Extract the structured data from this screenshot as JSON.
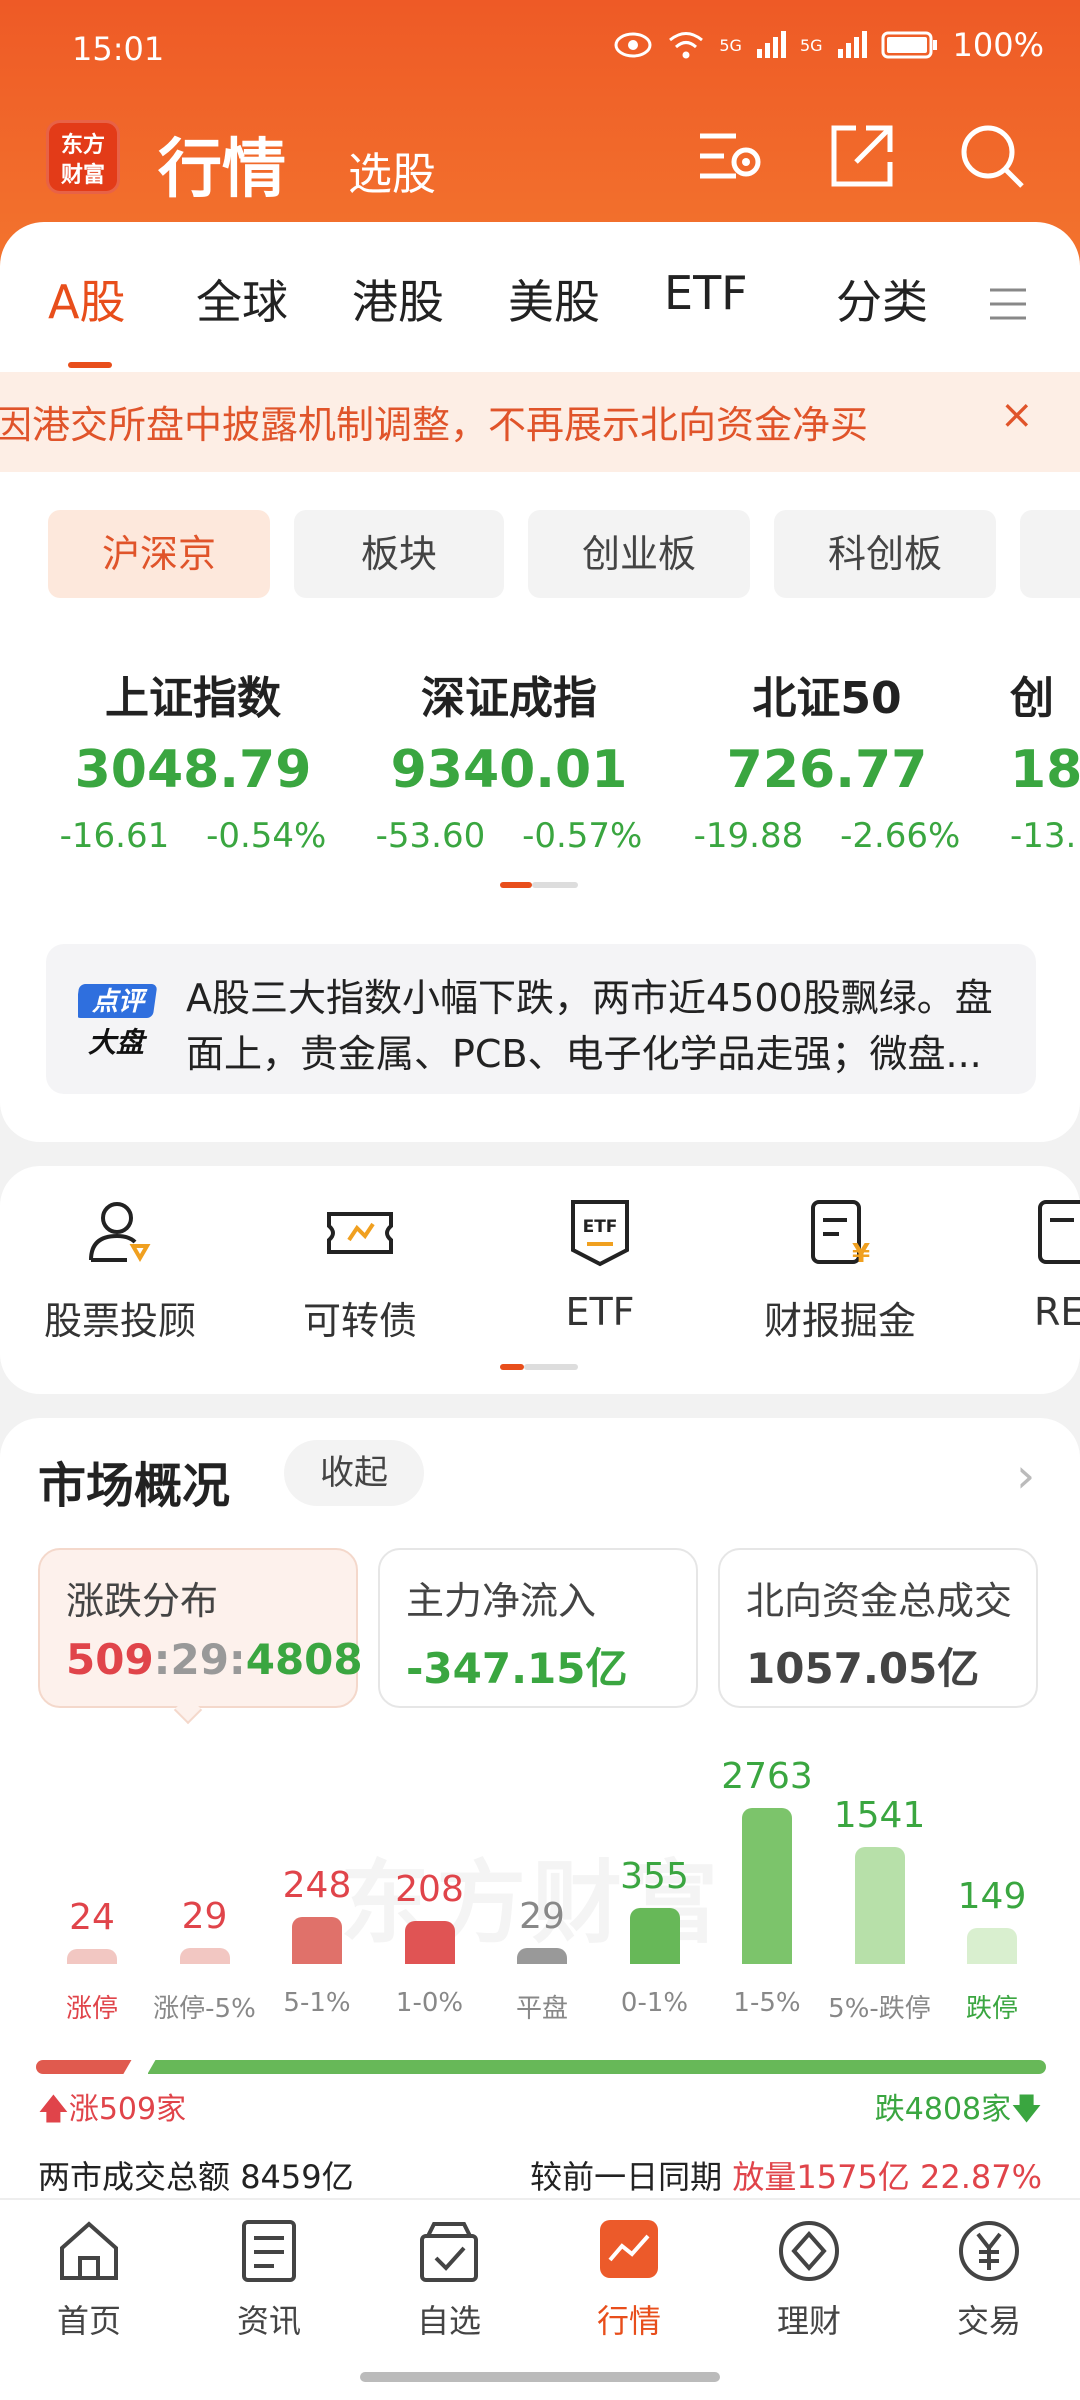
{
  "status": {
    "time": "15:01",
    "battery": "100%",
    "net1": "5G",
    "net2": "5G"
  },
  "header": {
    "logo_line1": "东方",
    "logo_line2": "财富",
    "title": "行情",
    "subtitle": "选股"
  },
  "tabs": [
    {
      "label": "A股"
    },
    {
      "label": "全球"
    },
    {
      "label": "港股"
    },
    {
      "label": "美股"
    },
    {
      "label": "ETF"
    },
    {
      "label": "分类"
    }
  ],
  "banner": {
    "text": "因港交所盘中披露机制调整，不再展示北向资金净买",
    "close": "×"
  },
  "pills": [
    {
      "label": "沪深京"
    },
    {
      "label": "板块"
    },
    {
      "label": "创业板"
    },
    {
      "label": "科创板"
    }
  ],
  "indices": [
    {
      "name": "上证指数",
      "value": "3048.79",
      "change": "-16.61",
      "pct": "-0.54%"
    },
    {
      "name": "深证成指",
      "value": "9340.01",
      "change": "-53.60",
      "pct": "-0.57%"
    },
    {
      "name": "北证50",
      "value": "726.77",
      "change": "-19.88",
      "pct": "-2.66%"
    },
    {
      "name": "创",
      "value": "18",
      "change": "-13.",
      "pct": ""
    }
  ],
  "review": {
    "badge1": "点评",
    "badge2": "大盘",
    "text": "A股三大指数小幅下跌，两市近4500股飘绿。盘面上，贵金属、PCB、电子化学品走强；微盘..."
  },
  "tools": [
    {
      "label": "股票投顾"
    },
    {
      "label": "可转债"
    },
    {
      "label": "ETF"
    },
    {
      "label": "财报掘金"
    },
    {
      "label": "RE"
    }
  ],
  "market": {
    "title": "市场概况",
    "collapse": "收起",
    "cards": [
      {
        "label": "涨跌分布",
        "v1": "509",
        "sep": ":",
        "v2": "29",
        "v3": "4808"
      },
      {
        "label": "主力净流入",
        "value": "-347.15亿"
      },
      {
        "label": "北向资金总成交",
        "value": "1057.05亿"
      }
    ],
    "watermark": "东方财富",
    "rise": "涨509家",
    "fall": "跌4808家",
    "turnover_label": "两市成交总额",
    "turnover_value": "8459亿",
    "compare_label": "较前一日同期",
    "compare_value": "放量1575亿",
    "compare_pct": "22.87%"
  },
  "chart_data": {
    "type": "bar",
    "categories": [
      "涨停",
      "涨停-5%",
      "5-1%",
      "1-0%",
      "平盘",
      "0-1%",
      "1-5%",
      "5%-跌停",
      "跌停"
    ],
    "values": [
      24,
      29,
      248,
      208,
      29,
      355,
      2763,
      1541,
      149
    ],
    "colors": [
      "#f2c7c2",
      "#f2c7c2",
      "#e0716a",
      "#e05454",
      "#999999",
      "#67b858",
      "#7cc46b",
      "#b7e0a9",
      "#d9efcf"
    ],
    "value_colors": [
      "#e0444a",
      "#e0444a",
      "#e0444a",
      "#e0444a",
      "#888888",
      "#3aa640",
      "#3aa640",
      "#3aa640",
      "#3aa640"
    ],
    "label_colors": [
      "#e0444a",
      "#888888",
      "#888888",
      "#888888",
      "#888888",
      "#888888",
      "#888888",
      "#888888",
      "#3aa640"
    ]
  },
  "nav": [
    {
      "label": "首页"
    },
    {
      "label": "资讯"
    },
    {
      "label": "自选"
    },
    {
      "label": "行情"
    },
    {
      "label": "理财"
    },
    {
      "label": "交易"
    }
  ],
  "colors": {
    "accent": "#e84e1b",
    "up": "#e0444a",
    "down": "#3aa640"
  }
}
